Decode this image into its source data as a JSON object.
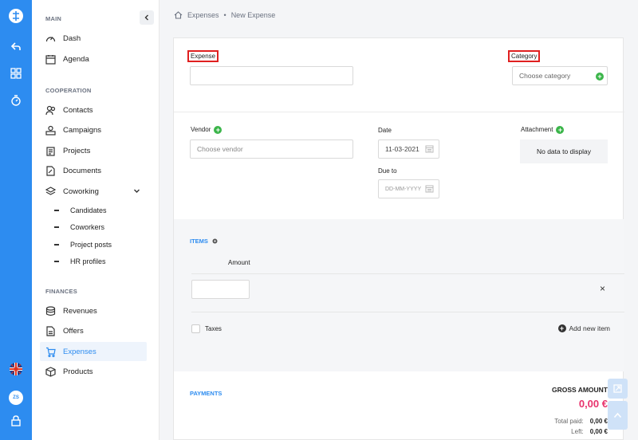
{
  "breadcrumb": {
    "root": "Expenses",
    "separator": "•",
    "current": "New Expense"
  },
  "sidebar": {
    "sections": {
      "main": "MAIN",
      "cooperation": "COOPERATION",
      "finances": "FINANCES"
    },
    "items": {
      "dash": "Dash",
      "agenda": "Agenda",
      "contacts": "Contacts",
      "campaigns": "Campaigns",
      "projects": "Projects",
      "documents": "Documents",
      "coworking": "Coworking",
      "revenues": "Revenues",
      "offers": "Offers",
      "expenses": "Expenses",
      "products": "Products"
    },
    "coworking_sub": {
      "candidates": "Candidates",
      "coworkers": "Coworkers",
      "project_posts": "Project posts",
      "hr_profiles": "HR profiles"
    }
  },
  "rail": {
    "avatar": "ZS"
  },
  "form": {
    "expense_label": "Expense",
    "category_label": "Category",
    "category_placeholder": "Choose category",
    "vendor_label": "Vendor",
    "vendor_placeholder": "Choose vendor",
    "date_label": "Date",
    "date_value": "11-03-2021",
    "due_label": "Due to",
    "due_placeholder": "DD-MM-YYYY",
    "attachment_label": "Attachment",
    "attachment_empty": "No data to display"
  },
  "items": {
    "title": "ITEMS",
    "amount_header": "Amount",
    "remove": "×",
    "taxes_label": "Taxes",
    "add_item": "Add new item"
  },
  "payments": {
    "title": "PAYMENTS",
    "gross_label": "GROSS AMOUNT",
    "gross_value": "0,00 €",
    "total_paid_label": "Total paid:",
    "total_paid_value": "0,00 €",
    "left_label": "Left:",
    "left_value": "0,00 €"
  },
  "colors": {
    "accent": "#2d8cf0",
    "highlight_box": "#e02020",
    "add_green": "#3bb54a",
    "gross_pink": "#e8336d"
  }
}
